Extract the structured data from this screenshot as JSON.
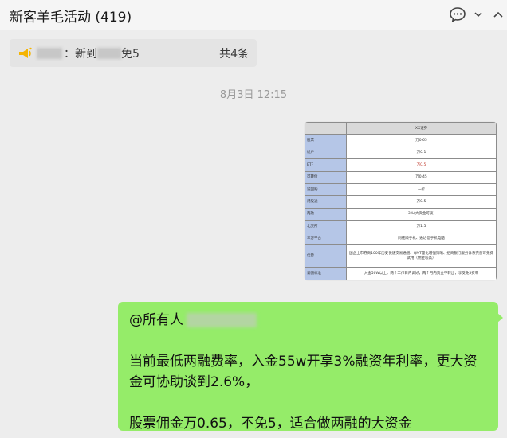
{
  "window": {
    "title": "新客羊毛活动 (419)"
  },
  "header_icons": [
    "chat-bubble-icon",
    "chevron-down-icon",
    "chevron-up-icon"
  ],
  "notice": {
    "text": "：新到",
    "text2": "免5",
    "count": "共4条",
    "icon": "megaphone-icon"
  },
  "timestamp": "8月3日 12:15",
  "image_table": {
    "header": [
      "",
      "XX证券"
    ],
    "rows": [
      {
        "label": "股票",
        "value": "万0.65",
        "highlight": false
      },
      {
        "label": "过户",
        "value": "万0.1",
        "highlight": false
      },
      {
        "label": "ETF",
        "value": "万0.5",
        "highlight": true
      },
      {
        "label": "可转债",
        "value": "万0.45",
        "highlight": false
      },
      {
        "label": "逆回购",
        "value": "一折",
        "highlight": false
      },
      {
        "label": "港股通",
        "value": "万0.5",
        "highlight": false
      },
      {
        "label": "两融",
        "value": "3%(大资金可谈)",
        "highlight": false
      },
      {
        "label": "北交所",
        "value": "万1.5",
        "highlight": false
      },
      {
        "label": "三方平台",
        "value": "同花顺手机、通达信手机电脑",
        "highlight": false
      },
      {
        "label": "优势",
        "value": "国企上市券商100年历史快速交易通道、QMT量化增强策略、招商银行服务体系完善可免费试用（佣金较高）",
        "highlight": false
      },
      {
        "label": "调佣标准",
        "value": "入金50W以上，两个工作日内调好，两个月内资金不转出，享受免5费率",
        "highlight": false
      }
    ]
  },
  "message": {
    "mention": "@所有人",
    "line1": "当前最低两融费率，入金55w开享3%融资年利率，更大资金可协助谈到2.6%，",
    "line2": "股票佣金万0.65，不免5，适合做两融的大资金"
  },
  "colors": {
    "bubble": "#95ec69",
    "background": "#ededed",
    "header": "#f5f5f5"
  }
}
